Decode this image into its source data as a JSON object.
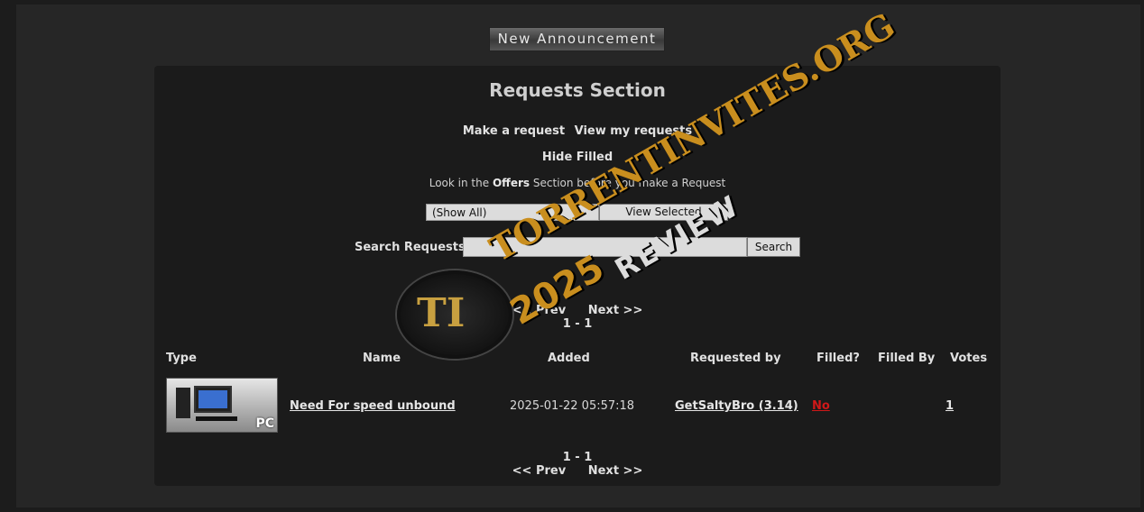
{
  "announcement_label": "New Announcement",
  "title": "Requests Section",
  "links": {
    "make_request": "Make a request",
    "view_my_requests": "View my requests",
    "hide_filled": "Hide Filled"
  },
  "offers_note": {
    "before": "Look in the",
    "bold": "Offers",
    "after": "Section before you make a Request"
  },
  "filter": {
    "selected": "(Show All)",
    "view_button": "View Selected"
  },
  "search": {
    "label": "Search Requests:",
    "value": "",
    "button": "Search"
  },
  "pager": {
    "prev": "<< Prev",
    "next": "Next >>",
    "range": "1 - 1"
  },
  "columns": [
    "Type",
    "Name",
    "Added",
    "Requested by",
    "Filled?",
    "Filled By",
    "Votes"
  ],
  "rows": [
    {
      "type_label": "PC",
      "name": "Need For speed unbound",
      "added": "2025-01-22 05:57:18",
      "requested_by": "GetSaltyBro (3.14)",
      "filled": "No",
      "filled_by": "",
      "votes": "1"
    }
  ],
  "watermark": {
    "monogram": "TI",
    "brand": "TORRENTINVITES.ORG",
    "year": "2025",
    "review": "REVIEW"
  },
  "colors": {
    "filled_no": "#d01818",
    "watermark_gold": "#c98e1e"
  }
}
